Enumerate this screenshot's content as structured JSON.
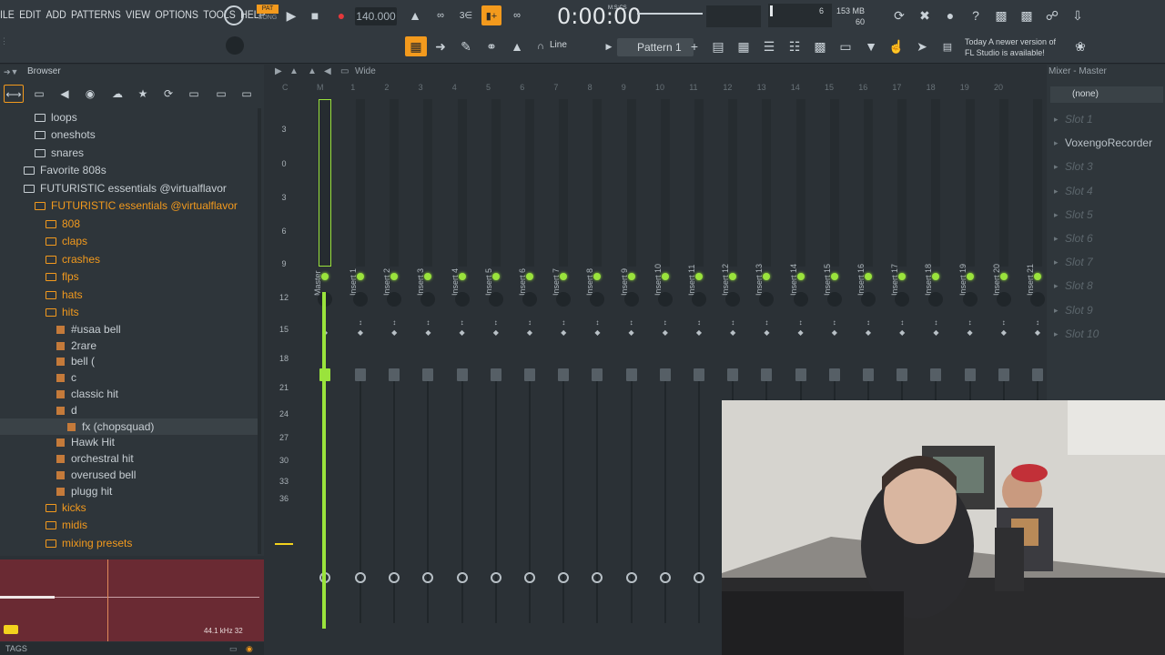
{
  "menu": [
    "ILE",
    "EDIT",
    "ADD",
    "PATTERNS",
    "VIEW",
    "OPTIONS",
    "TOOLS",
    "HELP"
  ],
  "transport": {
    "pat": "PAT",
    "song": "SONG",
    "tempo": "140.000",
    "time": "0:00:00",
    "time_unit": "M:S:CS",
    "cpu_voices": "6",
    "memory": "153 MB",
    "memory_sub": "60"
  },
  "toolbar": {
    "snap": "Line",
    "pattern": "Pattern 1",
    "news_line1": "Today  A newer version of",
    "news_line2": "FL Studio is available!"
  },
  "browser": {
    "title": "Browser",
    "items": [
      {
        "label": "loops",
        "kind": "folder",
        "color": "grey",
        "indent": 1
      },
      {
        "label": "oneshots",
        "kind": "folder",
        "color": "grey",
        "indent": 1
      },
      {
        "label": "snares",
        "kind": "folder",
        "color": "grey",
        "indent": 1
      },
      {
        "label": "Favorite 808s",
        "kind": "folder",
        "color": "grey",
        "indent": 0
      },
      {
        "label": "FUTURISTIC essentials @virtualflavor",
        "kind": "folder",
        "color": "grey",
        "indent": 0
      },
      {
        "label": "FUTURISTIC essentials @virtualflavor",
        "kind": "folder",
        "color": "orange",
        "indent": 1
      },
      {
        "label": "808",
        "kind": "folder",
        "color": "orange",
        "indent": 2
      },
      {
        "label": "claps",
        "kind": "folder",
        "color": "orange",
        "indent": 2
      },
      {
        "label": "crashes",
        "kind": "folder",
        "color": "orange",
        "indent": 2
      },
      {
        "label": "flps",
        "kind": "folder",
        "color": "orange",
        "indent": 2
      },
      {
        "label": "hats",
        "kind": "folder",
        "color": "orange",
        "indent": 2
      },
      {
        "label": "hits",
        "kind": "folder",
        "color": "orange",
        "indent": 2
      },
      {
        "label": "#usaa bell",
        "kind": "file",
        "color": "grey",
        "indent": 3
      },
      {
        "label": "2rare",
        "kind": "file",
        "color": "grey",
        "indent": 3
      },
      {
        "label": "bell (",
        "kind": "file",
        "color": "grey",
        "indent": 3
      },
      {
        "label": "c",
        "kind": "file",
        "color": "grey",
        "indent": 3
      },
      {
        "label": "classic hit",
        "kind": "file",
        "color": "grey",
        "indent": 3
      },
      {
        "label": "d",
        "kind": "file",
        "color": "grey",
        "indent": 3
      },
      {
        "label": "fx (chopsquad)",
        "kind": "file",
        "color": "grey",
        "indent": 4
      },
      {
        "label": "Hawk Hit",
        "kind": "file",
        "color": "grey",
        "indent": 3
      },
      {
        "label": "orchestral hit",
        "kind": "file",
        "color": "grey",
        "indent": 3
      },
      {
        "label": "overused bell",
        "kind": "file",
        "color": "grey",
        "indent": 3
      },
      {
        "label": "plugg hit",
        "kind": "file",
        "color": "grey",
        "indent": 3
      },
      {
        "label": "kicks",
        "kind": "folder",
        "color": "orange",
        "indent": 2
      },
      {
        "label": "midis",
        "kind": "folder",
        "color": "orange",
        "indent": 2
      },
      {
        "label": "mixing presets",
        "kind": "folder",
        "color": "orange",
        "indent": 2
      }
    ],
    "sample_rate": "44.1 kHz 32",
    "tags": "TAGS"
  },
  "mixer": {
    "view": "Wide",
    "title": "Mixer - Master",
    "track_numbers": [
      "C",
      "M",
      "1",
      "2",
      "3",
      "4",
      "5",
      "6",
      "7",
      "8",
      "9",
      "10",
      "11",
      "12",
      "13",
      "14",
      "15",
      "16",
      "17",
      "18",
      "19",
      "20"
    ],
    "tracks": [
      "Master",
      "Insert 1",
      "Insert 2",
      "Insert 3",
      "Insert 4",
      "Insert 5",
      "Insert 6",
      "Insert 7",
      "Insert 8",
      "Insert 9",
      "Insert 10",
      "Insert 11",
      "Insert 12",
      "Insert 13",
      "Insert 14",
      "Insert 15",
      "Insert 16",
      "Insert 17",
      "Insert 18",
      "Insert 19",
      "Insert 20",
      "Insert 21"
    ],
    "scale": [
      "3",
      "0",
      "3",
      "6",
      "9",
      "12",
      "15",
      "18",
      "21",
      "24",
      "27",
      "30",
      "33",
      "36"
    ],
    "input": "(none)",
    "slots": [
      {
        "label": "Slot 1",
        "active": false
      },
      {
        "label": "VoxengoRecorder",
        "active": true
      },
      {
        "label": "Slot 3",
        "active": false
      },
      {
        "label": "Slot 4",
        "active": false
      },
      {
        "label": "Slot 5",
        "active": false
      },
      {
        "label": "Slot 6",
        "active": false
      },
      {
        "label": "Slot 7",
        "active": false
      },
      {
        "label": "Slot 8",
        "active": false
      },
      {
        "label": "Slot 9",
        "active": false
      },
      {
        "label": "Slot 10",
        "active": false
      }
    ]
  },
  "colors": {
    "accent": "#f39a1d",
    "led": "#9ae33c",
    "panel": "#2e353a"
  }
}
